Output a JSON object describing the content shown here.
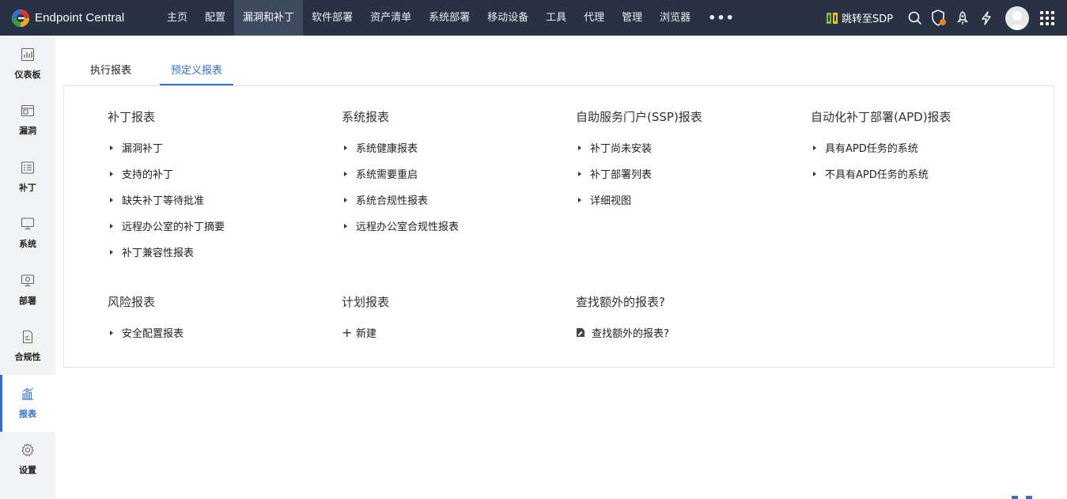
{
  "app": {
    "name": "Endpoint Central"
  },
  "nav": {
    "items": [
      "主页",
      "配置",
      "漏洞和补丁",
      "软件部署",
      "资产清单",
      "系统部署",
      "移动设备",
      "工具",
      "代理",
      "管理",
      "浏览器"
    ],
    "more": "•••",
    "active_index": 2
  },
  "topbar": {
    "sdp_label": "跳转至SDP",
    "icons": [
      "search-icon",
      "shield-icon",
      "rocket-icon",
      "lightning-icon"
    ]
  },
  "sidebar": {
    "items": [
      {
        "label": "仪表板",
        "icon": "dashboard-icon"
      },
      {
        "label": "漏洞",
        "icon": "vulnerability-icon"
      },
      {
        "label": "补丁",
        "icon": "patch-icon"
      },
      {
        "label": "系统",
        "icon": "system-icon"
      },
      {
        "label": "部署",
        "icon": "deployment-icon"
      },
      {
        "label": "合规性",
        "icon": "compliance-icon"
      },
      {
        "label": "报表",
        "icon": "reports-icon"
      },
      {
        "label": "设置",
        "icon": "settings-icon"
      }
    ],
    "active_index": 6
  },
  "tabs": [
    {
      "label": "执行报表",
      "active": false
    },
    {
      "label": "预定义报表",
      "active": true
    }
  ],
  "sections": {
    "patch": {
      "heading": "补丁报表",
      "links": [
        "漏洞补丁",
        "支持的补丁",
        "缺失补丁等待批准",
        "远程办公室的补丁摘要",
        "补丁兼容性报表"
      ]
    },
    "system": {
      "heading": "系统报表",
      "links": [
        "系统健康报表",
        "系统需要重启",
        "系统合规性报表",
        "远程办公室合规性报表"
      ]
    },
    "ssp": {
      "heading": "自助服务门户(SSP)报表",
      "links": [
        "补丁尚未安装",
        "补丁部署列表",
        "详细视图"
      ]
    },
    "apd": {
      "heading": "自动化补丁部署(APD)报表",
      "links": [
        "具有APD任务的系统",
        "不具有APD任务的系统"
      ]
    },
    "risk": {
      "heading": "风险报表",
      "links": [
        "安全配置报表"
      ]
    },
    "schedule": {
      "heading": "计划报表",
      "new_label": "新建"
    },
    "extra": {
      "heading": "查找额外的报表?",
      "link_label": "查找额外的报表?"
    }
  },
  "colors": {
    "topbar_bg": "#283244",
    "nav_active_bg": "#3d4a5f",
    "accent": "#2f6fcf",
    "sidebar_bg": "#f2f3f5",
    "notification_dot": "#f0811f"
  }
}
